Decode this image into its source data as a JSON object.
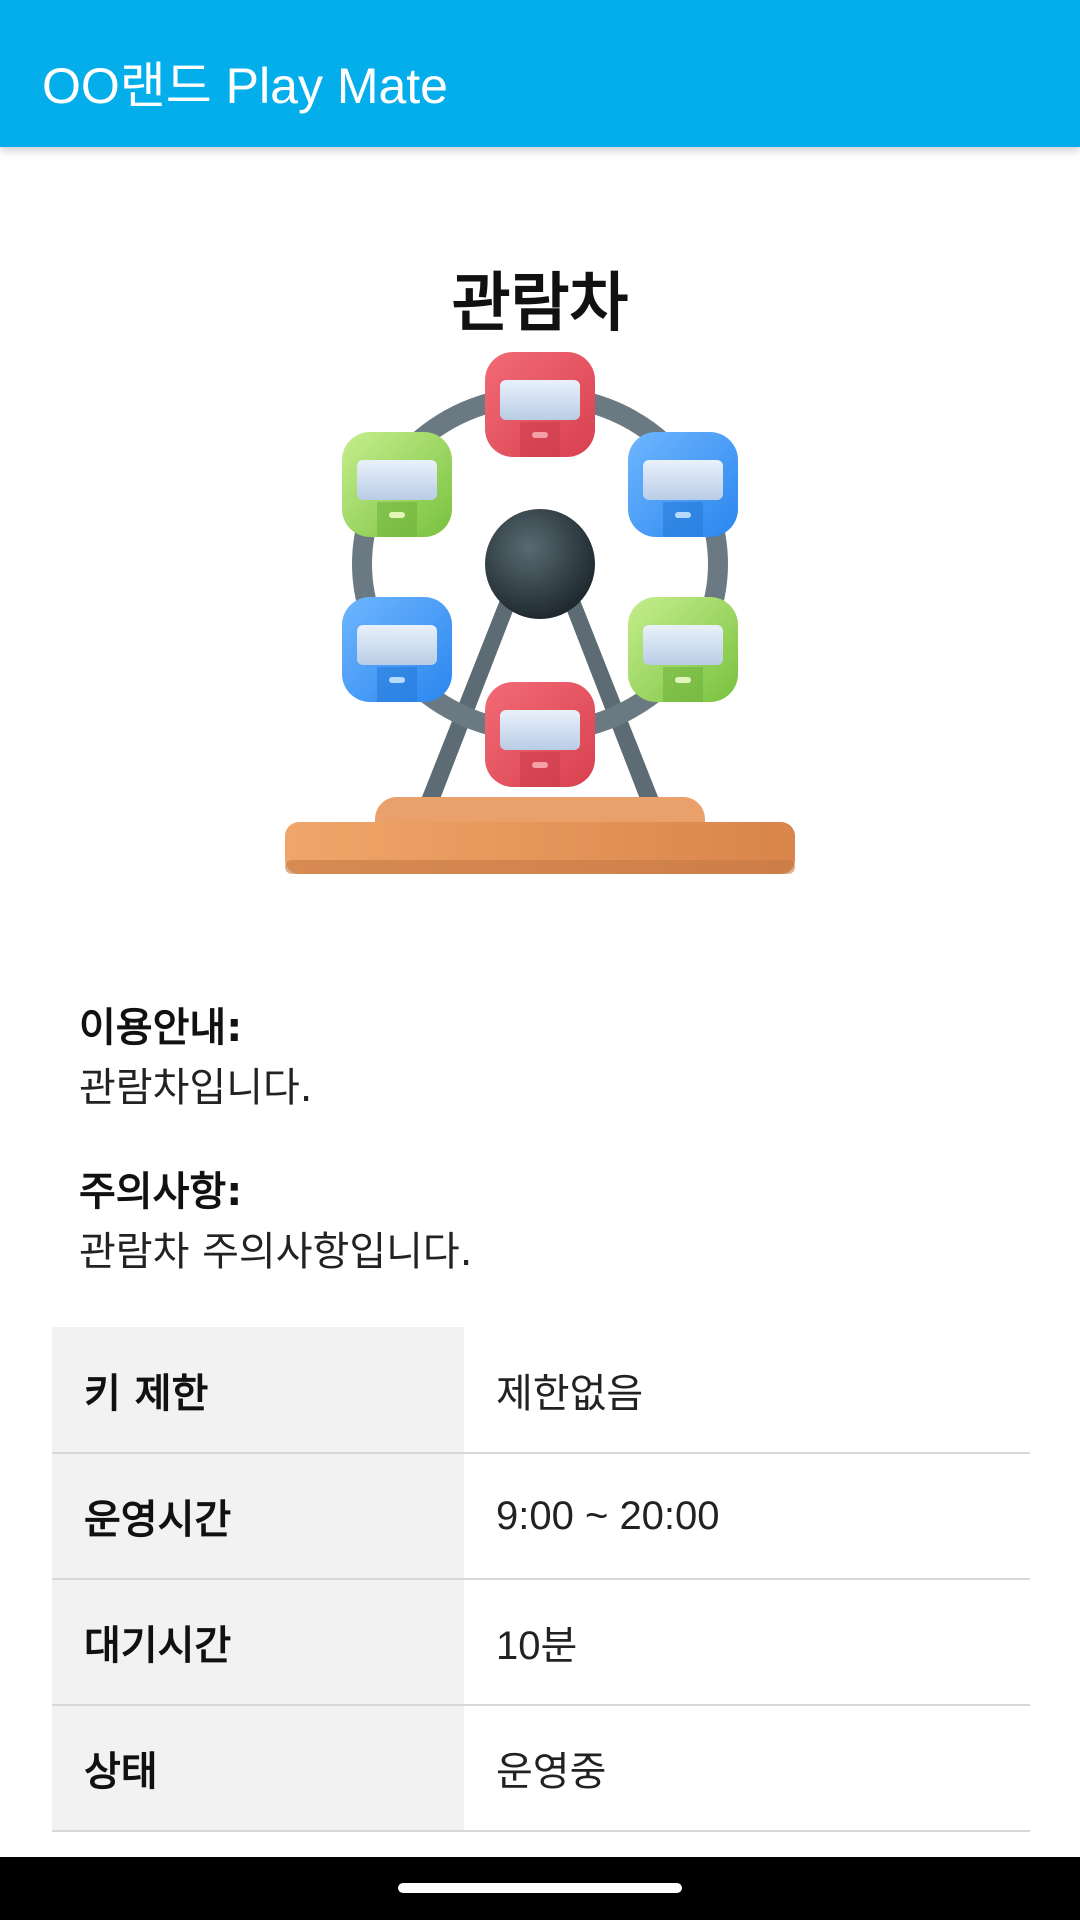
{
  "app_bar": {
    "title": "OO랜드 Play Mate"
  },
  "ride": {
    "name": "관람차",
    "image_icon": "ferris-wheel-icon"
  },
  "sections": {
    "guide": {
      "title": "이용안내:",
      "body": "관람차입니다."
    },
    "caution": {
      "title": "주의사항:",
      "body": "관람차 주의사항입니다."
    }
  },
  "info_table": [
    {
      "label": "키 제한",
      "value": "제한없음"
    },
    {
      "label": "운영시간",
      "value": "9:00 ~ 20:00"
    },
    {
      "label": "대기시간",
      "value": "10분"
    },
    {
      "label": "상태",
      "value": "운영중"
    }
  ],
  "colors": {
    "app_bar": "#03aeea",
    "label_background": "#f2f2f2",
    "cabin_red": "#e9505f",
    "cabin_blue": "#3d97f2",
    "cabin_green": "#8fcf52",
    "base": "#e8955a"
  }
}
